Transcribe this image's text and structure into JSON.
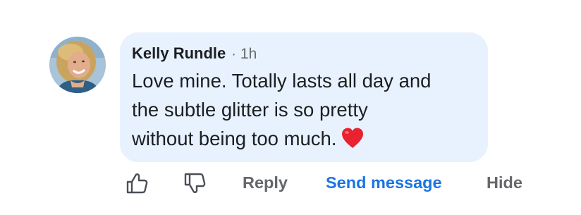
{
  "comment": {
    "author": "Kelly Rundle",
    "separator": "·",
    "time": "1h",
    "text": "Love mine. Totally lasts all day and\nthe subtle glitter is so pretty\nwithout being too much.",
    "emoji_icon": "red-heart-emoji",
    "avatar_icon": "profile-photo"
  },
  "actions": {
    "like_icon": "thumbs-up-icon",
    "dislike_icon": "thumbs-down-icon",
    "reply_label": "Reply",
    "send_message_label": "Send message",
    "hide_label": "Hide"
  },
  "colors": {
    "bubble_background": "#e8f2fe",
    "primary_text": "#1c1e21",
    "secondary_text": "#65676b",
    "accent_link": "#1a74e4",
    "heart_red": "#e8222e"
  }
}
